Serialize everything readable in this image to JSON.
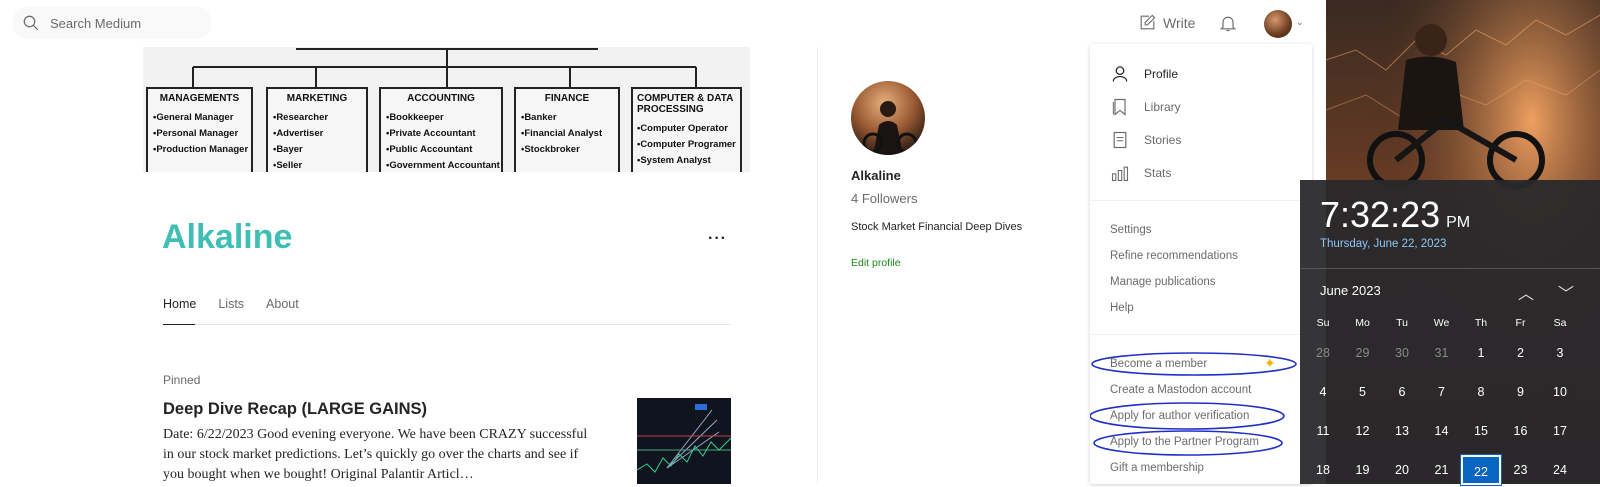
{
  "topbar": {
    "search_placeholder": "Search Medium",
    "write_label": "Write"
  },
  "org_chart": {
    "boxes": [
      {
        "title": "MANAGEMENTS",
        "items": [
          "•General Manager",
          "•Personal Manager",
          "•Production Manager"
        ]
      },
      {
        "title": "MARKETING",
        "items": [
          "•Researcher",
          "•Advertiser",
          "•Bayer",
          "•Seller"
        ]
      },
      {
        "title": "ACCOUNTING",
        "items": [
          "•Bookkeeper",
          "•Private Accountant",
          "•Public Accountant",
          "•Government Accountant"
        ]
      },
      {
        "title": "FINANCE",
        "items": [
          "•Banker",
          "•Financial Analyst",
          "•Stockbroker"
        ]
      },
      {
        "title": "COMPUTER & DATA PROCESSING",
        "items": [
          "•Computer Operator",
          "•Computer Programer",
          "•System Analyst"
        ]
      }
    ]
  },
  "profile": {
    "name": "Alkaline",
    "more": "···",
    "tabs": [
      {
        "label": "Home",
        "active": true
      },
      {
        "label": "Lists",
        "active": false
      },
      {
        "label": "About",
        "active": false
      }
    ],
    "pinned_label": "Pinned",
    "post_title": "Deep Dive Recap (LARGE GAINS)",
    "post_excerpt": "Date: 6/22/2023 Good evening everyone. We have been CRAZY successful in our stock market predictions. Let’s quickly go over the charts and see if you bought when we bought! Original Palantir Articl…"
  },
  "sidebar": {
    "name": "Alkaline",
    "followers": "4 Followers",
    "bio": "Stock Market Financial Deep Dives",
    "edit_profile": "Edit profile"
  },
  "dropdown": {
    "primary": [
      {
        "label": "Profile",
        "icon": "person-icon"
      },
      {
        "label": "Library",
        "icon": "bookmark-icon"
      },
      {
        "label": "Stories",
        "icon": "document-icon"
      },
      {
        "label": "Stats",
        "icon": "stats-icon"
      }
    ],
    "secondary": [
      "Settings",
      "Refine recommendations",
      "Manage publications",
      "Help"
    ],
    "tertiary": [
      "Become a member",
      "Create a Mastodon account",
      "Apply for author verification",
      "Apply to the Partner Program",
      "Gift a membership"
    ]
  },
  "clock": {
    "time": "7:32:23",
    "ampm": "PM",
    "date": "Thursday, June 22, 2023",
    "month": "June 2023",
    "weekdays": [
      "Su",
      "Mo",
      "Tu",
      "We",
      "Th",
      "Fr",
      "Sa"
    ],
    "days": [
      [
        {
          "d": "28",
          "other": true
        },
        {
          "d": "29",
          "other": true
        },
        {
          "d": "30",
          "other": true
        },
        {
          "d": "31",
          "other": true
        },
        {
          "d": "1"
        },
        {
          "d": "2"
        },
        {
          "d": "3"
        }
      ],
      [
        {
          "d": "4"
        },
        {
          "d": "5"
        },
        {
          "d": "6"
        },
        {
          "d": "7"
        },
        {
          "d": "8"
        },
        {
          "d": "9"
        },
        {
          "d": "10"
        }
      ],
      [
        {
          "d": "11"
        },
        {
          "d": "12"
        },
        {
          "d": "13"
        },
        {
          "d": "14"
        },
        {
          "d": "15"
        },
        {
          "d": "16"
        },
        {
          "d": "17"
        }
      ],
      [
        {
          "d": "18"
        },
        {
          "d": "19"
        },
        {
          "d": "20"
        },
        {
          "d": "21"
        },
        {
          "d": "22",
          "today": true
        },
        {
          "d": "23"
        },
        {
          "d": "24"
        }
      ]
    ]
  },
  "colors": {
    "brand_teal": "#3fbfb3",
    "edit_green": "#1a8917",
    "annotation_blue": "#1f2fc8",
    "today_blue": "#0a64c2"
  }
}
